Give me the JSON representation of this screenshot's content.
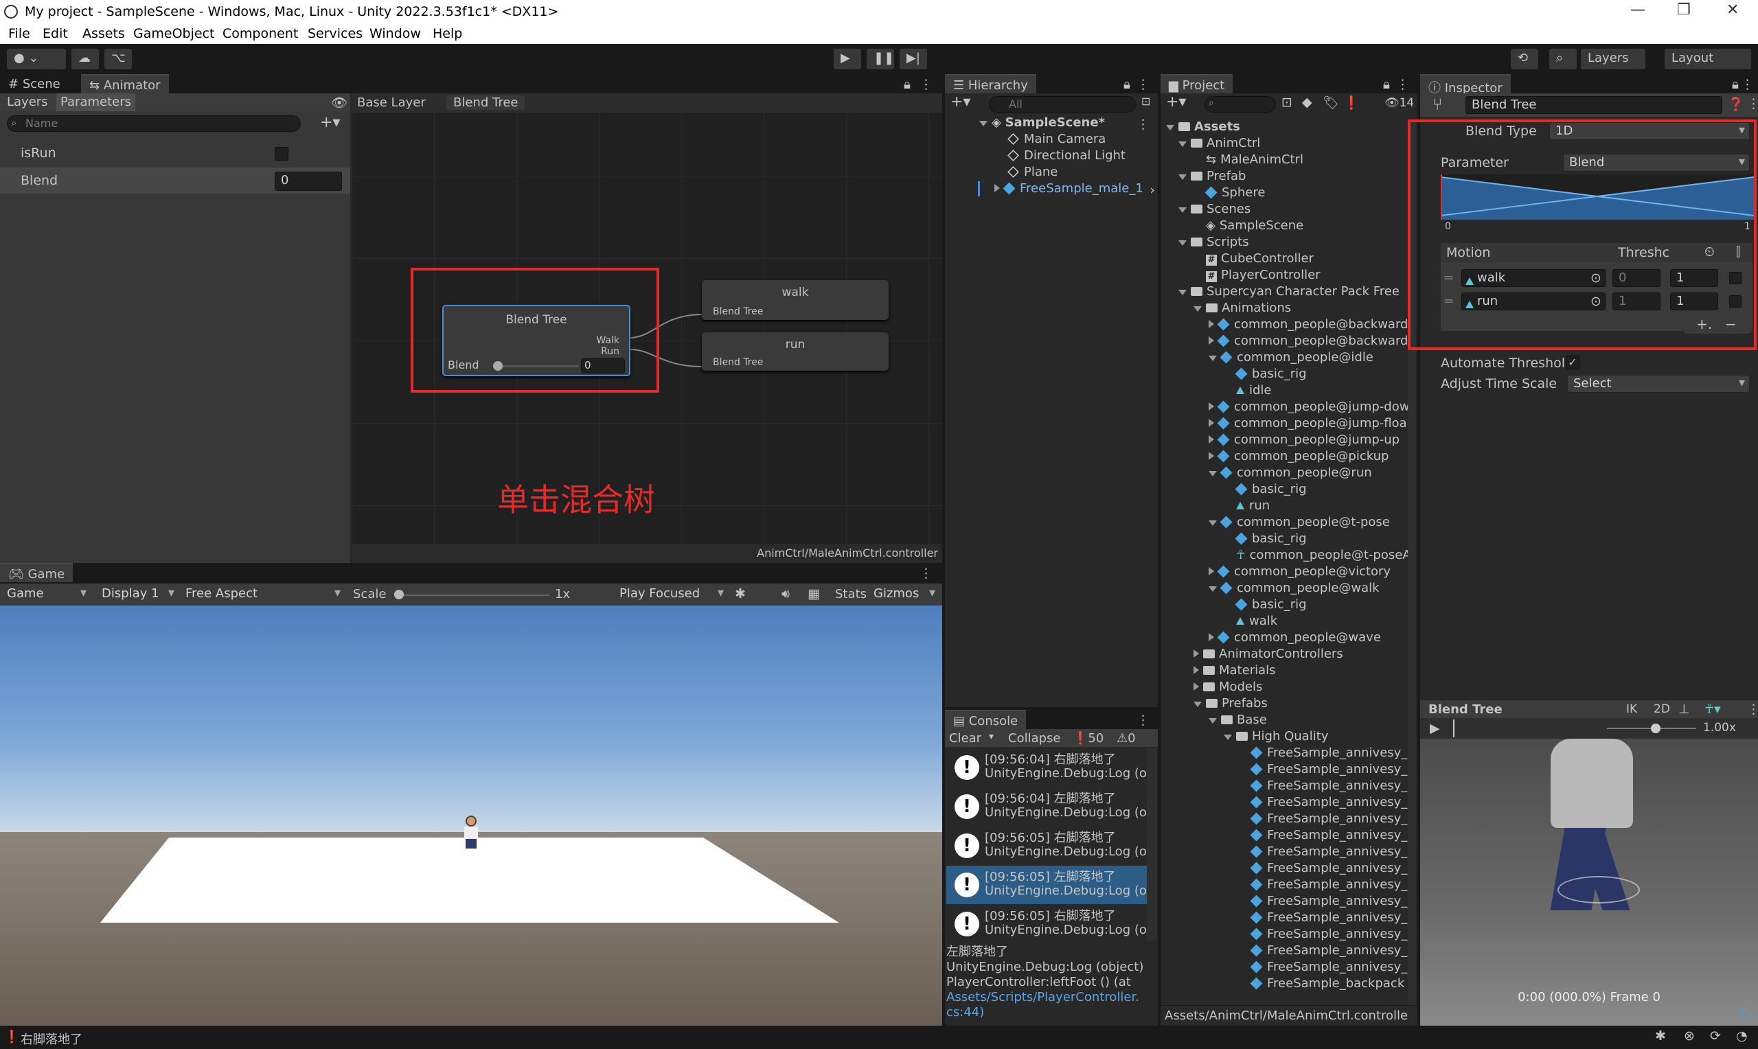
{
  "window": {
    "title": "My project - SampleScene - Windows, Mac, Linux - Unity 2022.3.53f1c1* <DX11>"
  },
  "menu": [
    "File",
    "Edit",
    "Assets",
    "GameObject",
    "Component",
    "Services",
    "Window",
    "Help"
  ],
  "toolbar": {
    "layers": "Layers",
    "layout": "Layout"
  },
  "animator": {
    "tabs": {
      "scene": "Scene",
      "animator": "Animator"
    },
    "subtabs": {
      "layers": "Layers",
      "parameters": "Parameters"
    },
    "search_placeholder": "Name",
    "breadcrumb": [
      "Base Layer",
      "Blend Tree"
    ],
    "params": [
      {
        "name": "isRun",
        "value": ""
      },
      {
        "name": "Blend",
        "value": "0"
      }
    ],
    "node": {
      "title": "Blend Tree",
      "out1": "Walk",
      "out2": "Run",
      "param": "Blend",
      "value": "0"
    },
    "children": [
      {
        "title": "walk",
        "sub": "Blend Tree"
      },
      {
        "title": "run",
        "sub": "Blend Tree"
      }
    ],
    "annotation": "单击混合树",
    "footer": "AnimCtrl/MaleAnimCtrl.controller"
  },
  "game": {
    "tab": "Game",
    "bar": {
      "mode": "Game",
      "display": "Display 1",
      "aspect": "Free Aspect",
      "scale": "Scale",
      "scale_value": "1x",
      "play": "Play Focused",
      "stats": "Stats",
      "gizmos": "Gizmos"
    }
  },
  "hierarchy": {
    "tab": "Hierarchy",
    "search": "All",
    "scene": "SampleScene*",
    "items": [
      "Main Camera",
      "Directional Light",
      "Plane",
      "FreeSample_male_1"
    ]
  },
  "console": {
    "tab": "Console",
    "clear": "Clear",
    "collapse": "Collapse",
    "count_log": "50",
    "count_warn": "0",
    "entries": [
      {
        "l1": "[09:56:04] 右脚落地了",
        "l2": "UnityEngine.Debug:Log (o"
      },
      {
        "l1": "[09:56:04] 左脚落地了",
        "l2": "UnityEngine.Debug:Log (o"
      },
      {
        "l1": "[09:56:05] 右脚落地了",
        "l2": "UnityEngine.Debug:Log (o"
      },
      {
        "l1": "[09:56:05] 左脚落地了",
        "l2": "UnityEngine.Debug:Log (o"
      },
      {
        "l1": "[09:56:05] 右脚落地了",
        "l2": "UnityEngine.Debug:Log (o"
      }
    ],
    "detail": [
      "左脚落地了",
      "UnityEngine.Debug:Log (object)",
      "PlayerController:leftFoot () (at",
      "Assets/Scripts/PlayerController.",
      "cs:44)"
    ]
  },
  "project": {
    "tab": "Project",
    "count": "14",
    "root": "Assets",
    "items": [
      {
        "t": "AnimCtrl",
        "d": 1,
        "k": "folder",
        "o": true
      },
      {
        "t": "MaleAnimCtrl",
        "d": 2,
        "k": "anim"
      },
      {
        "t": "Prefab",
        "d": 1,
        "k": "folder",
        "o": true
      },
      {
        "t": "Sphere",
        "d": 2,
        "k": "cube"
      },
      {
        "t": "Scenes",
        "d": 1,
        "k": "folder",
        "o": true
      },
      {
        "t": "SampleScene",
        "d": 2,
        "k": "scene"
      },
      {
        "t": "Scripts",
        "d": 1,
        "k": "folder",
        "o": true
      },
      {
        "t": "CubeController",
        "d": 2,
        "k": "script"
      },
      {
        "t": "PlayerController",
        "d": 2,
        "k": "script"
      },
      {
        "t": "Supercyan Character Pack Free",
        "d": 1,
        "k": "folder",
        "o": true
      },
      {
        "t": "Animations",
        "d": 2,
        "k": "folder",
        "o": true
      },
      {
        "t": "common_people@backward",
        "d": 3,
        "k": "cube",
        "c": true
      },
      {
        "t": "common_people@backward",
        "d": 3,
        "k": "cube",
        "c": true
      },
      {
        "t": "common_people@idle",
        "d": 3,
        "k": "cube",
        "o": true
      },
      {
        "t": "basic_rig",
        "d": 4,
        "k": "cube"
      },
      {
        "t": "idle",
        "d": 4,
        "k": "clip"
      },
      {
        "t": "common_people@jump-dow",
        "d": 3,
        "k": "cube",
        "c": true
      },
      {
        "t": "common_people@jump-floa",
        "d": 3,
        "k": "cube",
        "c": true
      },
      {
        "t": "common_people@jump-up",
        "d": 3,
        "k": "cube",
        "c": true
      },
      {
        "t": "common_people@pickup",
        "d": 3,
        "k": "cube",
        "c": true
      },
      {
        "t": "common_people@run",
        "d": 3,
        "k": "cube",
        "o": true
      },
      {
        "t": "basic_rig",
        "d": 4,
        "k": "cube"
      },
      {
        "t": "run",
        "d": 4,
        "k": "clip"
      },
      {
        "t": "common_people@t-pose",
        "d": 3,
        "k": "cube",
        "o": true
      },
      {
        "t": "basic_rig",
        "d": 4,
        "k": "cube"
      },
      {
        "t": "common_people@t-poseA",
        "d": 4,
        "k": "avatar"
      },
      {
        "t": "common_people@victory",
        "d": 3,
        "k": "cube",
        "c": true
      },
      {
        "t": "common_people@walk",
        "d": 3,
        "k": "cube",
        "o": true
      },
      {
        "t": "basic_rig",
        "d": 4,
        "k": "cube"
      },
      {
        "t": "walk",
        "d": 4,
        "k": "clip"
      },
      {
        "t": "common_people@wave",
        "d": 3,
        "k": "cube",
        "c": true
      },
      {
        "t": "AnimatorControllers",
        "d": 2,
        "k": "folder",
        "c": true
      },
      {
        "t": "Materials",
        "d": 2,
        "k": "folder",
        "c": true
      },
      {
        "t": "Models",
        "d": 2,
        "k": "folder",
        "c": true
      },
      {
        "t": "Prefabs",
        "d": 2,
        "k": "folder",
        "o": true
      },
      {
        "t": "Base",
        "d": 3,
        "k": "folder",
        "o": true
      },
      {
        "t": "High Quality",
        "d": 4,
        "k": "folder",
        "o": true
      },
      {
        "t": "FreeSample_annivesy_",
        "d": 5,
        "k": "cube"
      },
      {
        "t": "FreeSample_annivesy_",
        "d": 5,
        "k": "cube"
      },
      {
        "t": "FreeSample_annivesy_",
        "d": 5,
        "k": "cube"
      },
      {
        "t": "FreeSample_annivesy_",
        "d": 5,
        "k": "cube"
      },
      {
        "t": "FreeSample_annivesy_",
        "d": 5,
        "k": "cube"
      },
      {
        "t": "FreeSample_annivesy_",
        "d": 5,
        "k": "cube"
      },
      {
        "t": "FreeSample_annivesy_",
        "d": 5,
        "k": "cube"
      },
      {
        "t": "FreeSample_annivesy_",
        "d": 5,
        "k": "cube"
      },
      {
        "t": "FreeSample_annivesy_",
        "d": 5,
        "k": "cube"
      },
      {
        "t": "FreeSample_annivesy_",
        "d": 5,
        "k": "cube"
      },
      {
        "t": "FreeSample_annivesy_",
        "d": 5,
        "k": "cube"
      },
      {
        "t": "FreeSample_annivesy_",
        "d": 5,
        "k": "cube"
      },
      {
        "t": "FreeSample_annivesy_",
        "d": 5,
        "k": "cube"
      },
      {
        "t": "FreeSample_annivesy_",
        "d": 5,
        "k": "cube"
      },
      {
        "t": "FreeSample_backpack",
        "d": 5,
        "k": "cube"
      }
    ],
    "path": "Assets/AnimCtrl/MaleAnimCtrl.controlle"
  },
  "inspector": {
    "tab": "Inspector",
    "name": "Blend Tree",
    "blend_type_label": "Blend Type",
    "blend_type": "1D",
    "parameter_label": "Parameter",
    "parameter": "Blend",
    "range_min": "0",
    "range_max": "1",
    "motion_header": "Motion",
    "threshold_header": "Threshc",
    "motions": [
      {
        "name": "walk",
        "threshold": "0",
        "speed": "1"
      },
      {
        "name": "run",
        "threshold": "1",
        "speed": "1"
      }
    ],
    "automate_label": "Automate Threshold",
    "automate_check": "✓",
    "adjust_label": "Adjust Time Scale",
    "adjust_value": "Select",
    "preview": {
      "title": "Blend Tree",
      "ik": "IK",
      "twod": "2D",
      "speed": "1.00x",
      "time": "0:00 (000.0%) Frame 0"
    }
  },
  "status": "右脚落地了"
}
